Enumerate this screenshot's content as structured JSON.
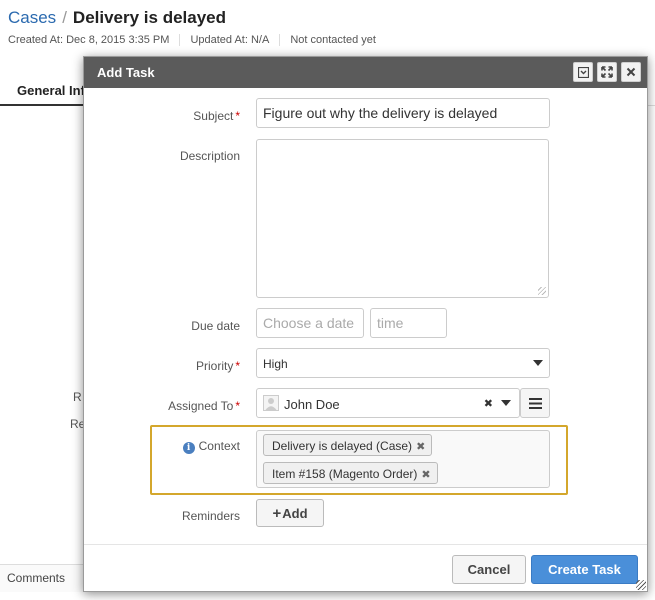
{
  "background": {
    "breadcrumb": {
      "link": "Cases",
      "separator": "/",
      "title": "Delivery is delayed"
    },
    "meta": {
      "created": "Created At: Dec 8, 2015 3:35 PM",
      "updated": "Updated At: N/A",
      "contacted": "Not contacted yet"
    },
    "tab_label": "General Information",
    "left_text_1": "R",
    "left_text_2": "Re",
    "comments_label": "Comments"
  },
  "dialog": {
    "title": "Add Task",
    "controls": [
      "minimize-icon",
      "maximize-icon",
      "close-icon"
    ],
    "fields": {
      "subject": {
        "label": "Subject",
        "value": "Figure out why the delivery is delayed"
      },
      "description": {
        "label": "Description",
        "value": ""
      },
      "due_date": {
        "label": "Due date",
        "date_placeholder": "Choose a date",
        "time_placeholder": "time"
      },
      "priority": {
        "label": "Priority",
        "value": "High"
      },
      "assigned_to": {
        "label": "Assigned To",
        "value": "John Doe",
        "clear": "✖"
      },
      "context": {
        "label": "Context",
        "tags": [
          "Delivery is delayed (Case)",
          "Item #158 (Magento Order)"
        ]
      },
      "reminders": {
        "label": "Reminders",
        "add_label": "Add"
      }
    },
    "buttons": {
      "cancel": "Cancel",
      "create": "Create Task"
    },
    "colors": {
      "titlebar": "#5b5b5b",
      "primary": "#4a8fd9",
      "highlight": "#d4a72c",
      "required": "#cc0000"
    }
  }
}
